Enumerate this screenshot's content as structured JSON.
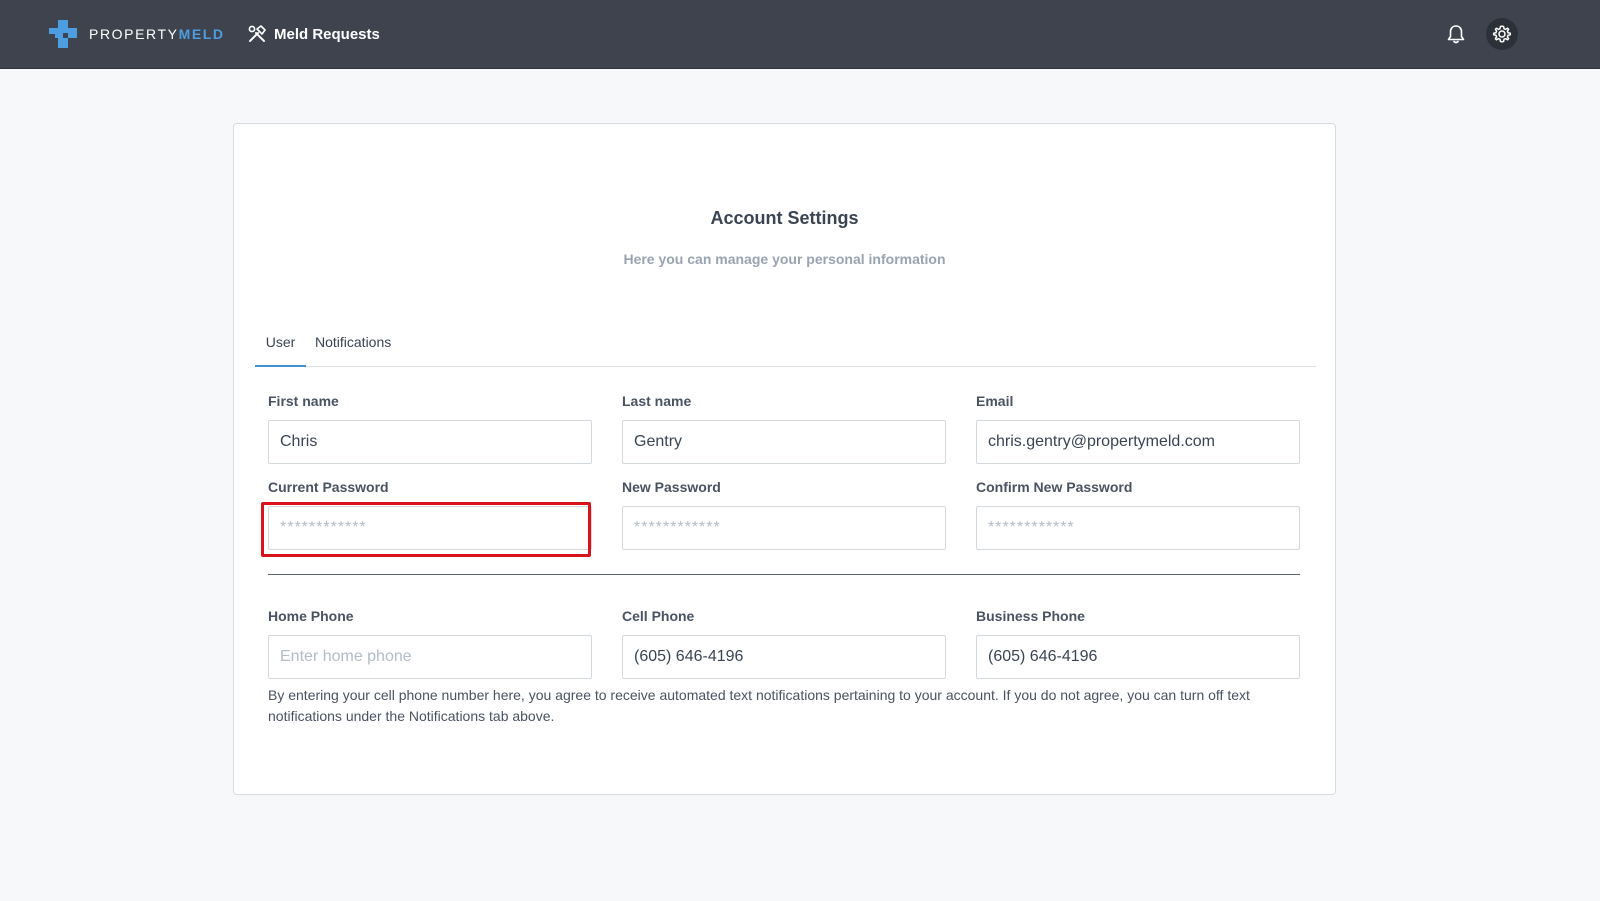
{
  "header": {
    "logo_text_property": "PROPERTY",
    "logo_text_meld": "MELD",
    "nav_label": "Meld Requests",
    "nav_icon": "tools-icon",
    "bell_icon": "bell-icon",
    "settings_icon": "gear-icon"
  },
  "page": {
    "title": "Account Settings",
    "subtitle": "Here you can manage your personal information"
  },
  "tabs": [
    {
      "label": "User",
      "active": true
    },
    {
      "label": "Notifications",
      "active": false
    }
  ],
  "form": {
    "first_name": {
      "label": "First name",
      "value": "Chris"
    },
    "last_name": {
      "label": "Last name",
      "value": "Gentry"
    },
    "email": {
      "label": "Email",
      "value": "chris.gentry@propertymeld.com"
    },
    "current_password": {
      "label": "Current Password",
      "placeholder": "************"
    },
    "new_password": {
      "label": "New Password",
      "placeholder": "************"
    },
    "confirm_password": {
      "label": "Confirm New Password",
      "placeholder": "************"
    },
    "home_phone": {
      "label": "Home Phone",
      "placeholder": "Enter home phone",
      "value": ""
    },
    "cell_phone": {
      "label": "Cell Phone",
      "value": "(605) 646-4196"
    },
    "business_phone": {
      "label": "Business Phone",
      "value": "(605) 646-4196"
    },
    "consent_text": "By entering your cell phone number here, you agree to receive automated text notifications pertaining to your account. If you do not agree, you can turn off text notifications under the Notifications tab above."
  },
  "colors": {
    "topbar": "#3e434e",
    "accent": "#4d9ee0",
    "highlight": "#d9121b"
  }
}
